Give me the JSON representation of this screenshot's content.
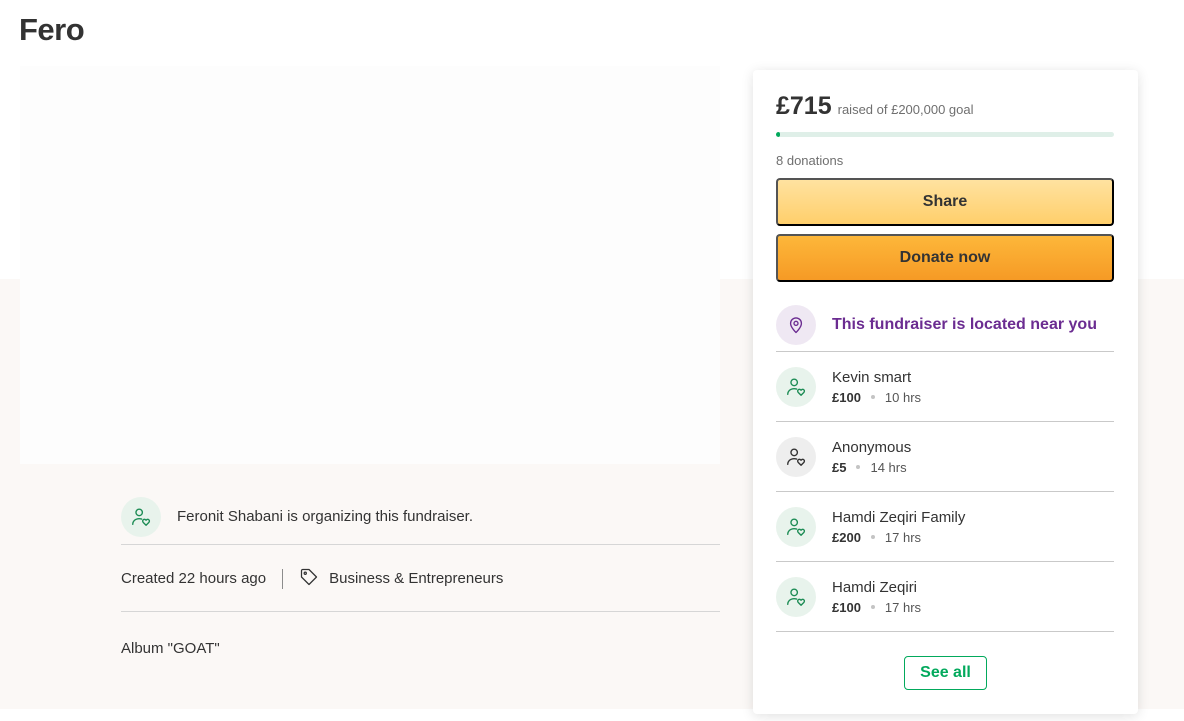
{
  "title": "Fero",
  "organizer": {
    "text": "Feronit Shabani is organizing this fundraiser."
  },
  "meta": {
    "created": "Created 22 hours ago",
    "category": "Business & Entrepreneurs"
  },
  "description": "Album \"GOAT\"",
  "card": {
    "amount": "£715",
    "goal_text": "raised of £200,000 goal",
    "progress_fraction": 0.0036,
    "donations_count": "8 donations",
    "share_label": "Share",
    "donate_label": "Donate now",
    "near_label": "This fundraiser is located near you",
    "see_all_label": "See all"
  },
  "donors": [
    {
      "name": "Kevin smart",
      "amount": "£100",
      "time": "10 hrs",
      "avatar": "green"
    },
    {
      "name": "Anonymous",
      "amount": "£5",
      "time": "14 hrs",
      "avatar": "grey"
    },
    {
      "name": "Hamdi Zeqiri Family",
      "amount": "£200",
      "time": "17 hrs",
      "avatar": "green"
    },
    {
      "name": "Hamdi Zeqiri",
      "amount": "£100",
      "time": "17 hrs",
      "avatar": "green"
    }
  ],
  "colors": {
    "brand_green": "#02a95c",
    "near_purple": "#6b2c91",
    "donate_orange": "#f69a25",
    "share_yellow": "#ffd77e"
  },
  "icons": {
    "organizer": "user-heart-icon",
    "category": "tag-icon",
    "location": "location-pin-icon"
  }
}
